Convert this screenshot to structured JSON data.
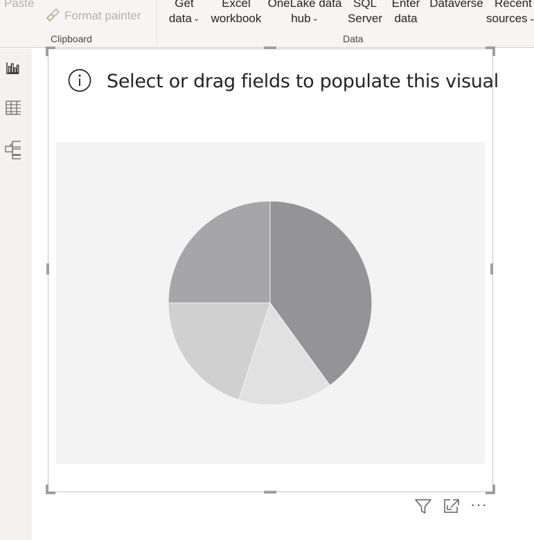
{
  "ribbon": {
    "clipboard": {
      "paste_label": "Paste",
      "format_painter_label": "Format painter",
      "group_label": "Clipboard"
    },
    "data": {
      "group_label": "Data",
      "get_data": {
        "line1": "Get",
        "line2": "data"
      },
      "excel_workbook": {
        "line1": "Excel",
        "line2": "workbook"
      },
      "onelake": {
        "line1": "OneLake data",
        "line2": "hub"
      },
      "sql_server": {
        "line1": "SQL",
        "line2": "Server"
      },
      "enter_data": {
        "line1": "Enter",
        "line2": "data"
      },
      "dataverse": {
        "line1": "Dataverse"
      },
      "recent_sources": {
        "line1": "Recent",
        "line2": "sources"
      }
    }
  },
  "left_rail": {
    "icons": [
      "report-view-icon",
      "table-view-icon",
      "model-view-icon"
    ]
  },
  "visual": {
    "message": "Select or drag fields to populate this visual",
    "icon": "info-icon",
    "header_icons": [
      "filter-icon",
      "focus-mode-icon",
      "more-options-icon"
    ],
    "more_glyph": "···"
  },
  "chart_data": {
    "type": "pie",
    "title": "",
    "placeholder": true,
    "slices": [
      {
        "value": 40,
        "color": "#949496"
      },
      {
        "value": 15,
        "color": "#e1e1e2"
      },
      {
        "value": 20,
        "color": "#d0d0d1"
      },
      {
        "value": 25,
        "color": "#a6a6a8"
      }
    ]
  }
}
